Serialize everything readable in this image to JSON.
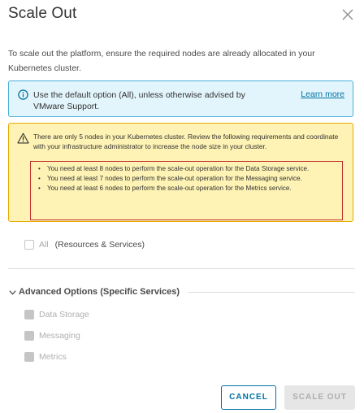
{
  "dialog": {
    "title": "Scale Out",
    "intro": "To scale out the platform, ensure the required nodes are already allocated in your Kubernetes cluster."
  },
  "info": {
    "text": "Use the default option (All), unless otherwise advised by VMware Support.",
    "link": "Learn more"
  },
  "warning": {
    "text": "There are only 5 nodes in your Kubernetes cluster. Review the following requirements and coordinate with your infrastructure administrator to increase the node size in your cluster.",
    "requirements": [
      "You need at least 8 nodes to perform the scale-out operation for the Data Storage service.",
      "You need at least 7 nodes to perform the scale-out operation for the Messaging service.",
      "You need at least 6 nodes to perform the scale-out operation for the Metrics service."
    ]
  },
  "all_option": {
    "label": "All",
    "sublabel": "(Resources & Services)"
  },
  "advanced": {
    "title": "Advanced Options (Specific Services)",
    "services": [
      "Data Storage",
      "Messaging",
      "Metrics"
    ]
  },
  "buttons": {
    "cancel": "CANCEL",
    "scale_out": "SCALE OUT"
  },
  "colors": {
    "info_bg": "#e3f5fc",
    "info_border": "#49afd9",
    "warning_bg": "#fef3b5",
    "warning_border": "#e7a800",
    "highlight_border": "#c0302c",
    "primary": "#0072a3"
  }
}
